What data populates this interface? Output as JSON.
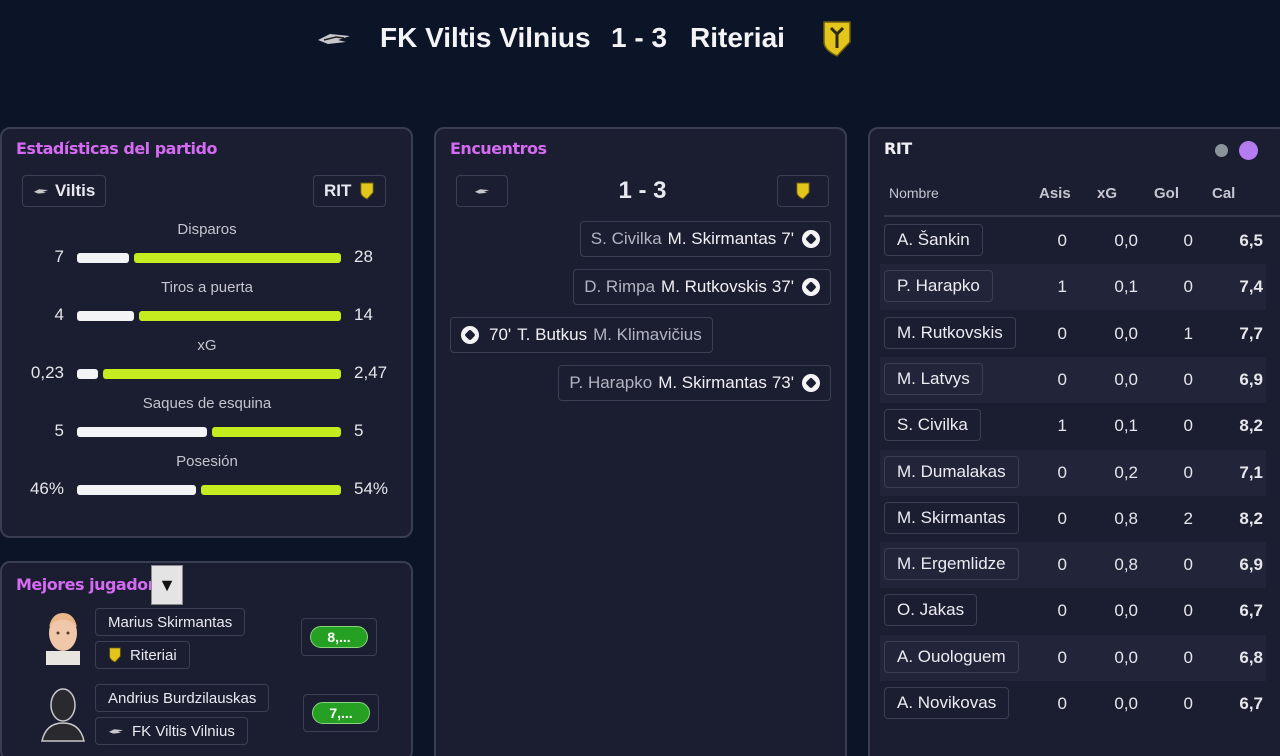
{
  "header": {
    "home_team": "FK Viltis Vilnius",
    "score": "1 - 3",
    "away_team": "Riteriai"
  },
  "stats_panel": {
    "title": "Estadísticas del partido",
    "home_short": "Viltis",
    "away_short": "RIT",
    "stats": [
      {
        "label": "Disparos",
        "home": "7",
        "away": "28",
        "home_share": 0.2
      },
      {
        "label": "Tiros a puerta",
        "home": "4",
        "away": "14",
        "home_share": 0.22
      },
      {
        "label": "xG",
        "home": "0,23",
        "away": "2,47",
        "home_share": 0.08
      },
      {
        "label": "Saques de esquina",
        "home": "5",
        "away": "5",
        "home_share": 0.5
      },
      {
        "label": "Posesión",
        "home": "46%",
        "away": "54%",
        "home_share": 0.46
      }
    ]
  },
  "best_players": {
    "title": "Mejores jugadores",
    "dropdown_icon": "▼",
    "players": [
      {
        "name": "Marius Skirmantas",
        "team": "Riteriai",
        "rating": "8,..."
      },
      {
        "name": "Andrius Burdzilauskas",
        "team": "FK Viltis Vilnius",
        "rating": "7,..."
      }
    ]
  },
  "events_panel": {
    "title": "Encuentros",
    "score": "1 - 3",
    "events": [
      {
        "assist": "S. Civilka",
        "scorer": "M. Skirmantas",
        "minute": "7'",
        "side": "away"
      },
      {
        "assist": "D. Rimpa",
        "scorer": "M. Rutkovskis",
        "minute": "37'",
        "side": "away"
      },
      {
        "assist": "M. Klimavičius",
        "scorer": "T. Butkus",
        "minute": "70'",
        "side": "home"
      },
      {
        "assist": "P. Harapko",
        "scorer": "M. Skirmantas",
        "minute": "73'",
        "side": "away"
      }
    ]
  },
  "table_panel": {
    "title": "RIT",
    "columns": {
      "name": "Nombre",
      "assists": "Asis",
      "xg": "xG",
      "goals": "Gol",
      "rating": "Cal"
    },
    "rows": [
      {
        "name": "A. Šankin",
        "assists": "0",
        "xg": "0,0",
        "goals": "0",
        "rating": "6,5"
      },
      {
        "name": "P. Harapko",
        "assists": "1",
        "xg": "0,1",
        "goals": "0",
        "rating": "7,4"
      },
      {
        "name": "M. Rutkovskis",
        "assists": "0",
        "xg": "0,0",
        "goals": "1",
        "rating": "7,7"
      },
      {
        "name": "M. Latvys",
        "assists": "0",
        "xg": "0,0",
        "goals": "0",
        "rating": "6,9"
      },
      {
        "name": "S. Civilka",
        "assists": "1",
        "xg": "0,1",
        "goals": "0",
        "rating": "8,2"
      },
      {
        "name": "M. Dumalakas",
        "assists": "0",
        "xg": "0,2",
        "goals": "0",
        "rating": "7,1"
      },
      {
        "name": "M. Skirmantas",
        "assists": "0",
        "xg": "0,8",
        "goals": "2",
        "rating": "8,2"
      },
      {
        "name": "M. Ergemlidze",
        "assists": "0",
        "xg": "0,8",
        "goals": "0",
        "rating": "6,9"
      },
      {
        "name": "O. Jakas",
        "assists": "0",
        "xg": "0,0",
        "goals": "0",
        "rating": "6,7"
      },
      {
        "name": "A. Ouologuem",
        "assists": "0",
        "xg": "0,0",
        "goals": "0",
        "rating": "6,8"
      },
      {
        "name": "A. Novikovas",
        "assists": "0",
        "xg": "0,0",
        "goals": "0",
        "rating": "6,7"
      }
    ]
  },
  "colors": {
    "accent_pink": "#d46bf2",
    "bar_home": "#f4f4f6",
    "bar_away": "#c4ec1e",
    "rating_pill": "#26a023",
    "toggle_active": "#b57cf2",
    "toggle_inactive": "#8a949a"
  }
}
